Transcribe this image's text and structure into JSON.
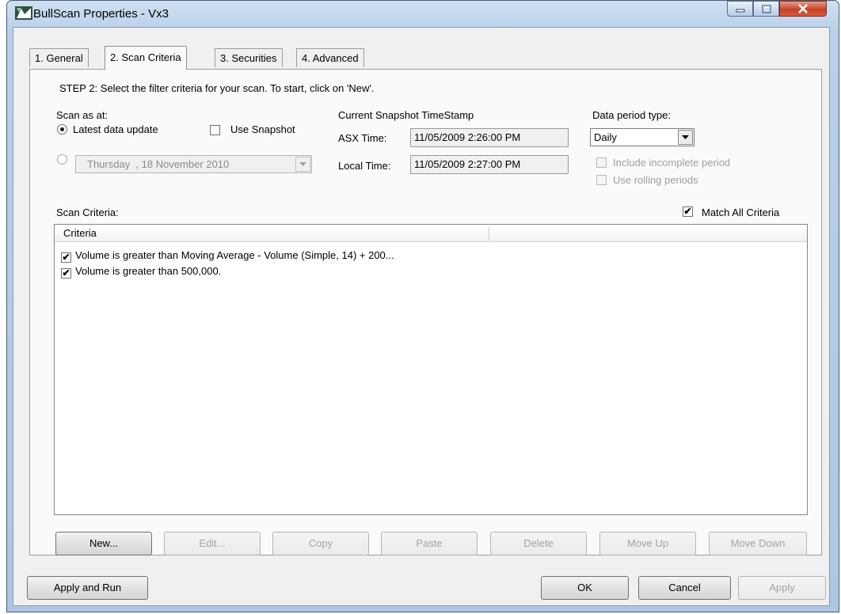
{
  "window": {
    "title": "BullScan Properties - Vx3"
  },
  "tabs": [
    {
      "label": "1. General"
    },
    {
      "label": "2. Scan Criteria"
    },
    {
      "label": "3. Securities"
    },
    {
      "label": "4. Advanced"
    }
  ],
  "active_tab": "2. Scan Criteria",
  "step_text": "STEP 2: Select the filter criteria for your scan. To start, click on 'New'.",
  "scan_as_at": {
    "label": "Scan as at:",
    "latest_label": "Latest data update",
    "latest_selected": true,
    "use_snapshot_label": "Use Snapshot",
    "use_snapshot_checked": false,
    "date_value": "Thursday  , 18 November 2010"
  },
  "snapshot": {
    "heading": "Current Snapshot TimeStamp",
    "asx_label": "ASX Time:",
    "asx_value": "11/05/2009 2:26:00 PM",
    "local_label": "Local Time:",
    "local_value": "11/05/2009 2:27:00 PM"
  },
  "period": {
    "label": "Data period type:",
    "selected": "Daily",
    "include_incomplete_label": "Include incomplete period",
    "rolling_label": "Use rolling periods"
  },
  "criteria": {
    "label": "Scan Criteria:",
    "match_all_label": "Match All Criteria",
    "match_all_checked": true,
    "column_header": "Criteria",
    "rows": [
      {
        "text": "Volume is greater than Moving Average - Volume (Simple, 14) + 200...",
        "checked": true
      },
      {
        "text": "Volume is greater than 500,000.",
        "checked": true
      }
    ]
  },
  "buttons": {
    "new": "New...",
    "edit": "Edit...",
    "copy": "Copy",
    "paste": "Paste",
    "delete": "Delete",
    "move_up": "Move Up",
    "move_down": "Move Down",
    "apply_run": "Apply and Run",
    "ok": "OK",
    "cancel": "Cancel",
    "apply": "Apply"
  },
  "colors": {
    "title_bar": "#b9d0ea",
    "close_button": "#c4432a",
    "dialog_bg": "#f0f0f0"
  }
}
